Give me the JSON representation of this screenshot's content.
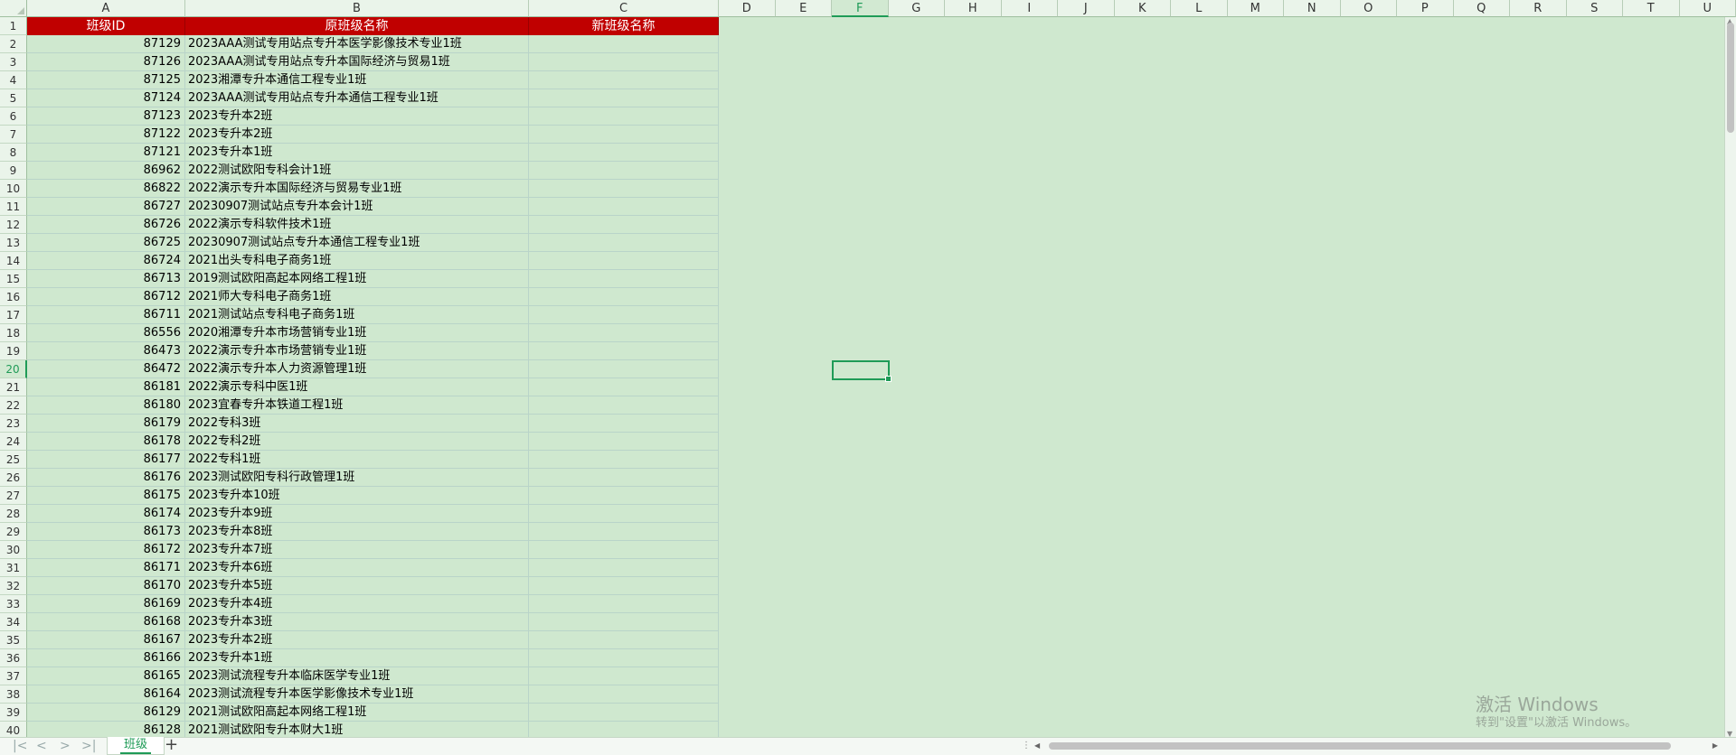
{
  "sheet": {
    "columns": [
      "A",
      "B",
      "C",
      "D",
      "E",
      "F",
      "G",
      "H",
      "I",
      "J",
      "K",
      "L",
      "M",
      "N",
      "O",
      "P",
      "Q",
      "R",
      "S",
      "T",
      "U"
    ],
    "header_row": {
      "a": "班级ID",
      "b": "原班级名称",
      "c": "新班级名称"
    },
    "row_numbers": [
      "1",
      "2",
      "3",
      "4",
      "5",
      "6",
      "7",
      "8",
      "9",
      "10",
      "11",
      "12",
      "13",
      "14",
      "15",
      "16",
      "17",
      "18",
      "19",
      "20",
      "21",
      "22",
      "23",
      "24",
      "25",
      "26",
      "27",
      "28",
      "29",
      "30",
      "31",
      "32",
      "33",
      "34",
      "35",
      "36",
      "37",
      "38",
      "39",
      "40"
    ],
    "active_cell": "F20",
    "rows": [
      {
        "id": "87129",
        "name": "2023AAA测试专用站点专升本医学影像技术专业1班"
      },
      {
        "id": "87126",
        "name": "2023AAA测试专用站点专升本国际经济与贸易1班"
      },
      {
        "id": "87125",
        "name": "2023湘潭专升本通信工程专业1班"
      },
      {
        "id": "87124",
        "name": "2023AAA测试专用站点专升本通信工程专业1班"
      },
      {
        "id": "87123",
        "name": "2023专升本2班"
      },
      {
        "id": "87122",
        "name": "2023专升本2班"
      },
      {
        "id": "87121",
        "name": "2023专升本1班"
      },
      {
        "id": "86962",
        "name": "2022测试欧阳专科会计1班"
      },
      {
        "id": "86822",
        "name": "2022演示专升本国际经济与贸易专业1班"
      },
      {
        "id": "86727",
        "name": "20230907测试站点专升本会计1班"
      },
      {
        "id": "86726",
        "name": "2022演示专科软件技术1班"
      },
      {
        "id": "86725",
        "name": "20230907测试站点专升本通信工程专业1班"
      },
      {
        "id": "86724",
        "name": "2021出头专科电子商务1班"
      },
      {
        "id": "86713",
        "name": "2019测试欧阳高起本网络工程1班"
      },
      {
        "id": "86712",
        "name": "2021师大专科电子商务1班"
      },
      {
        "id": "86711",
        "name": "2021测试站点专科电子商务1班"
      },
      {
        "id": "86556",
        "name": "2020湘潭专升本市场营销专业1班"
      },
      {
        "id": "86473",
        "name": "2022演示专升本市场营销专业1班"
      },
      {
        "id": "86472",
        "name": "2022演示专升本人力资源管理1班"
      },
      {
        "id": "86181",
        "name": "2022演示专科中医1班"
      },
      {
        "id": "86180",
        "name": "2023宜春专升本铁道工程1班"
      },
      {
        "id": "86179",
        "name": "2022专科3班"
      },
      {
        "id": "86178",
        "name": "2022专科2班"
      },
      {
        "id": "86177",
        "name": "2022专科1班"
      },
      {
        "id": "86176",
        "name": "2023测试欧阳专科行政管理1班"
      },
      {
        "id": "86175",
        "name": "2023专升本10班"
      },
      {
        "id": "86174",
        "name": "2023专升本9班"
      },
      {
        "id": "86173",
        "name": "2023专升本8班"
      },
      {
        "id": "86172",
        "name": "2023专升本7班"
      },
      {
        "id": "86171",
        "name": "2023专升本6班"
      },
      {
        "id": "86170",
        "name": "2023专升本5班"
      },
      {
        "id": "86169",
        "name": "2023专升本4班"
      },
      {
        "id": "86168",
        "name": "2023专升本3班"
      },
      {
        "id": "86167",
        "name": "2023专升本2班"
      },
      {
        "id": "86166",
        "name": "2023专升本1班"
      },
      {
        "id": "86165",
        "name": "2023测试流程专升本临床医学专业1班"
      },
      {
        "id": "86164",
        "name": "2023测试流程专升本医学影像技术专业1班"
      },
      {
        "id": "86129",
        "name": "2021测试欧阳高起本网络工程1班"
      },
      {
        "id": "86128",
        "name": "2021测试欧阳专升本财大1班"
      }
    ]
  },
  "tabs": {
    "active_label": "班级",
    "add_icon": "plus-icon"
  },
  "nav_icons": [
    "first-sheet-icon",
    "prev-sheet-icon",
    "next-sheet-icon",
    "last-sheet-icon"
  ],
  "watermark": {
    "title": "激活 Windows",
    "subtitle": "转到\"设置\"以激活 Windows。"
  },
  "colors": {
    "header_bg": "#c00000",
    "header_text": "#ffffff",
    "sheet_bg": "#cfe8cf",
    "accent": "#1f9b57"
  }
}
